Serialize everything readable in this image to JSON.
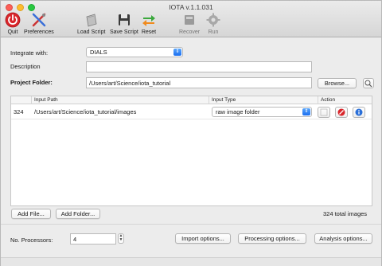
{
  "window": {
    "title": "IOTA v.1.1.031"
  },
  "toolbar": {
    "quit": "Quit",
    "preferences": "Preferences",
    "load_script": "Load Script",
    "save_script": "Save Script",
    "reset": "Reset",
    "recover": "Recover",
    "run": "Run"
  },
  "form": {
    "integrate_label": "Integrate with:",
    "integrate_value": "DIALS",
    "description_label": "Description",
    "description_value": "",
    "project_folder_label": "Project Folder:",
    "project_folder_value": "/Users/art/Science/iota_tutorial",
    "browse_label": "Browse..."
  },
  "table": {
    "headers": [
      "",
      "Input Path",
      "Input Type",
      "Action"
    ],
    "rows": [
      {
        "count": "324",
        "path": "/Users/art/Science/iota_tutorial/images",
        "type": "raw image folder"
      }
    ]
  },
  "buttons": {
    "add_file": "Add File...",
    "add_folder": "Add Folder..."
  },
  "status": {
    "total_images": "324 total images"
  },
  "processors": {
    "label": "No. Processors:",
    "value": "4"
  },
  "options": {
    "import": "Import options...",
    "processing": "Processing options...",
    "analysis": "Analysis options..."
  },
  "colors": {
    "accent_blue": "#1b6ff0",
    "quit_red": "#d9262b",
    "reset_green": "#3aa83c",
    "reset_orange": "#f08a1d"
  }
}
